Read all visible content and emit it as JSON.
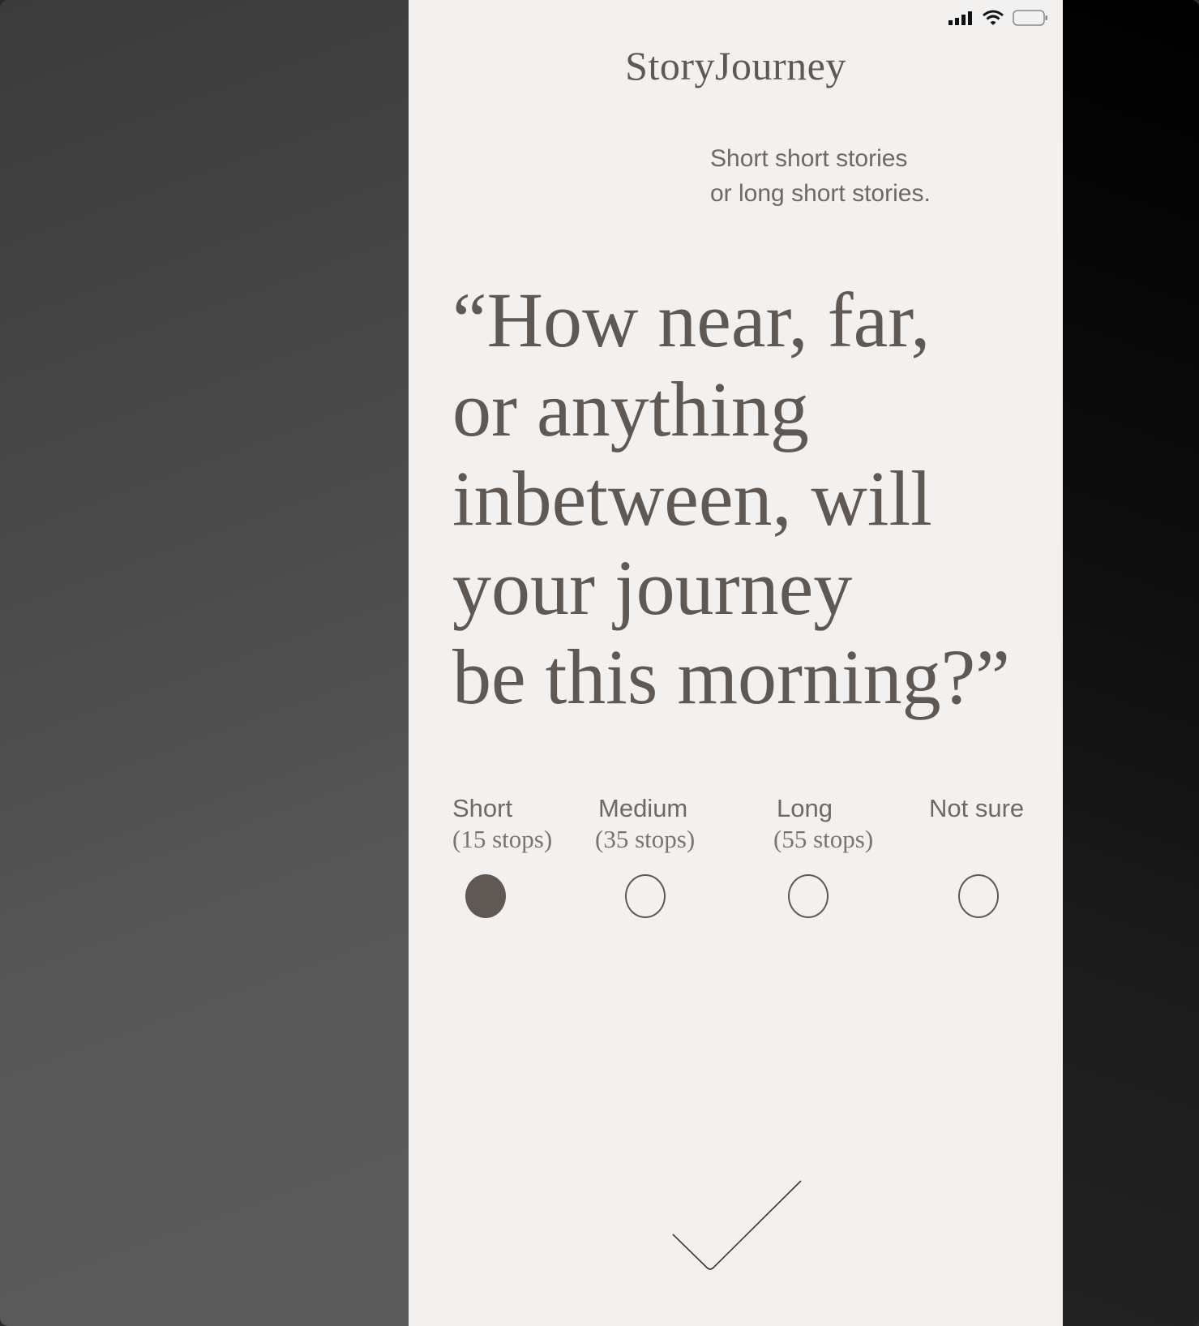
{
  "app": {
    "brand": "StoryJourney",
    "tagline": [
      "Short short stories",
      "or long short stories."
    ]
  },
  "question": {
    "lines": [
      "“How near, far,",
      "or anything",
      "inbetween, will",
      "your journey",
      "be this morning?”"
    ]
  },
  "options": [
    {
      "label": "Short",
      "sub": "(15 stops)",
      "selected": true
    },
    {
      "label": "Medium",
      "sub": "(35 stops)",
      "selected": false
    },
    {
      "label": "Long",
      "sub": "(55 stops)",
      "selected": false
    },
    {
      "label": "Not sure",
      "sub": "",
      "selected": false
    }
  ],
  "status_bar": {
    "icons": [
      "cellular-signal-icon",
      "wifi-icon",
      "battery-icon"
    ]
  },
  "confirm": {
    "icon": "checkmark-icon"
  },
  "colors": {
    "ink": "#5f5853",
    "paper": "#f2f1ef",
    "muted": "#6e6965"
  }
}
